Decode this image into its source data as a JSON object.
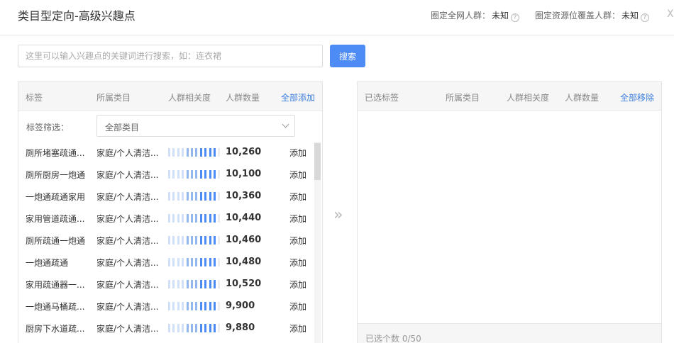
{
  "header": {
    "title": "类目型定向-高级兴趣点",
    "stat1_label": "圈定全网人群：",
    "stat1_value": "未知",
    "stat2_label": "圈定资源位覆盖人群：",
    "stat2_value": "未知",
    "help_icon": "?"
  },
  "search": {
    "placeholder": "这里可以输入兴趣点的关键词进行搜索，如：连衣裙",
    "button_label": "搜索"
  },
  "left": {
    "columns": [
      "标签",
      "所属类目",
      "人群相关度",
      "人群数量"
    ],
    "add_all": "全部添加",
    "filter_label": "标签筛选：",
    "filter_value": "全部类目",
    "rows": [
      {
        "name": "厕所堵塞疏通...",
        "category": "家庭/个人清洁...",
        "count": "10,260",
        "action": "添加",
        "relevance": 0.9
      },
      {
        "name": "厕所厨房一炮通",
        "category": "家庭/个人清洁...",
        "count": "10,100",
        "action": "添加",
        "relevance": 0.9
      },
      {
        "name": "一炮通疏通家用",
        "category": "家庭/个人清洁...",
        "count": "10,360",
        "action": "添加",
        "relevance": 0.9
      },
      {
        "name": "家用管道疏通...",
        "category": "家庭/个人清洁...",
        "count": "10,440",
        "action": "添加",
        "relevance": 0.9
      },
      {
        "name": "厕所疏通一炮通",
        "category": "家庭/个人清洁...",
        "count": "10,460",
        "action": "添加",
        "relevance": 0.9
      },
      {
        "name": "一炮通疏通",
        "category": "家庭/个人清洁...",
        "count": "10,480",
        "action": "添加",
        "relevance": 0.9
      },
      {
        "name": "家用疏通器一...",
        "category": "家庭/个人清洁...",
        "count": "10,520",
        "action": "添加",
        "relevance": 0.9
      },
      {
        "name": "一炮通马桶疏...",
        "category": "家庭/个人清洁...",
        "count": "9,900",
        "action": "添加",
        "relevance": 0.9
      },
      {
        "name": "厨房下水道疏...",
        "category": "家庭/个人清洁...",
        "count": "9,880",
        "action": "添加",
        "relevance": 0.9
      }
    ]
  },
  "right": {
    "columns": [
      "已选标签",
      "所属类目",
      "人群相关度",
      "人群数量"
    ],
    "remove_all": "全部移除",
    "footer": "已选个数 0/50"
  },
  "transfer_glyph": "»",
  "close_glyph": "X",
  "icons": {
    "help": "help-circle-icon",
    "close": "close-icon",
    "transfer": "double-chevron-right-icon",
    "dropdown": "chevron-down-icon"
  },
  "colors": {
    "accent": "#4d8cf4",
    "link": "#3b7cdd",
    "bar_light": "#cfe0f8",
    "bar_dark": "#4d8cf4"
  }
}
